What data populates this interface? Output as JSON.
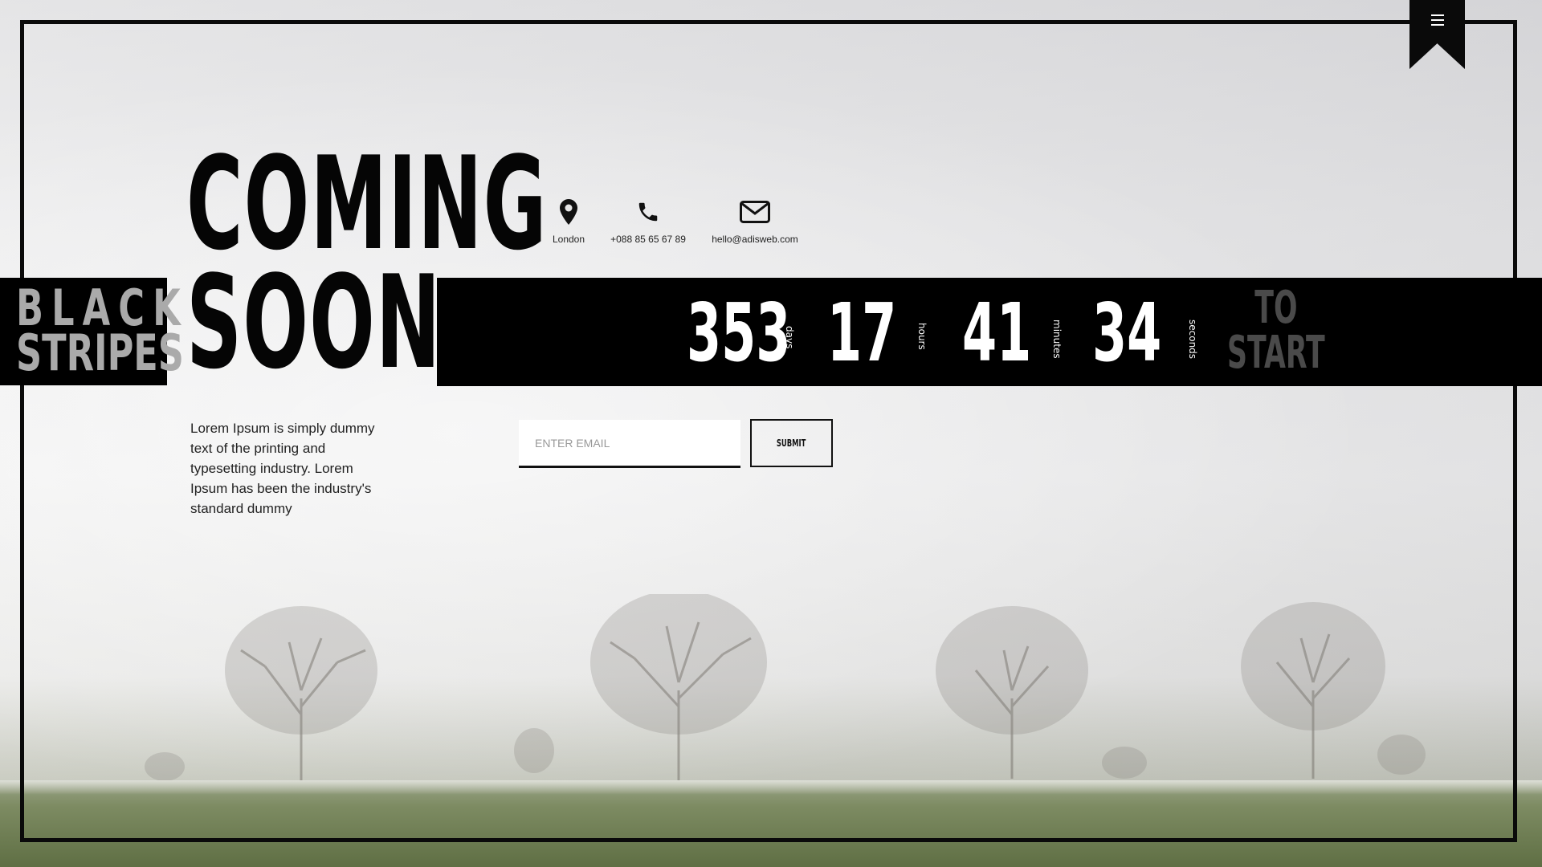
{
  "brand": {
    "line1": "BLACK",
    "line2": "STRIPES"
  },
  "hero": {
    "line1": "COMING",
    "line2": "SOON"
  },
  "contacts": [
    {
      "icon": "map-pin-icon",
      "text": "London"
    },
    {
      "icon": "phone-icon",
      "text": "+088 85 65 67 89"
    },
    {
      "icon": "envelope-icon",
      "text": "hello@adisweb.com"
    }
  ],
  "countdown": {
    "days": {
      "value": "353",
      "label": "days"
    },
    "hours": {
      "value": "17",
      "label": "hours"
    },
    "minutes": {
      "value": "41",
      "label": "minutes"
    },
    "seconds": {
      "value": "34",
      "label": "seconds"
    },
    "suffix_line1": "TO",
    "suffix_line2": "START"
  },
  "description": "Lorem Ipsum is simply dummy text of the printing and typesetting industry. Lorem Ipsum has been the industry's standard dummy",
  "form": {
    "email_placeholder": "ENTER EMAIL",
    "submit_label": "SUBMIT"
  },
  "colors": {
    "primary": "#000000",
    "text": "#222222",
    "muted": "#4a4a4a",
    "logo_text": "#aaaaaa"
  }
}
